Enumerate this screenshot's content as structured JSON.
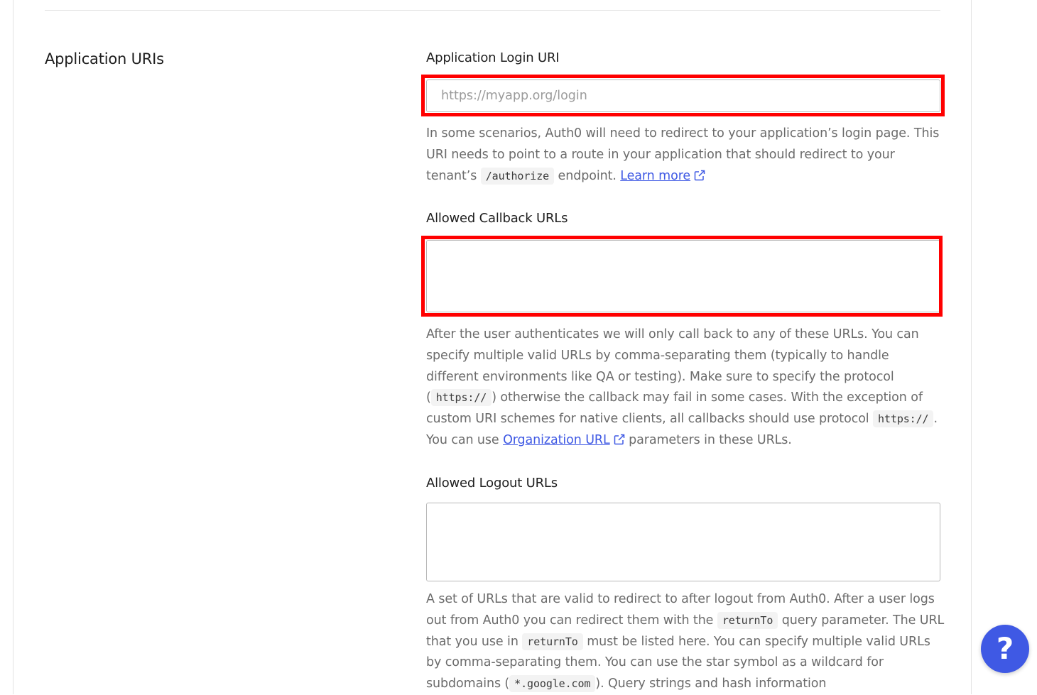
{
  "section": {
    "title": "Application URIs"
  },
  "login_uri": {
    "label": "Application Login URI",
    "placeholder": "https://myapp.org/login",
    "value": "",
    "help_1": "In some scenarios, Auth0 will need to redirect to your application’s login page. This URI needs to point to a route in your application that should redirect to your tenant’s",
    "help_code": "/authorize",
    "help_2": "endpoint.",
    "link": "Learn more"
  },
  "callback_urls": {
    "label": "Allowed Callback URLs",
    "value": "",
    "help_1": "After the user authenticates we will only call back to any of these URLs. You can specify multiple valid URLs by comma-separating them (typically to handle different environments like QA or testing). Make sure to specify the protocol (",
    "help_code_1": "https://",
    "help_2": ") otherwise the callback may fail in some cases. With the exception of custom URI schemes for native clients, all callbacks should use protocol",
    "help_code_2": "https://",
    "help_3": ". You can use",
    "link": "Organization URL",
    "help_4": "parameters in these URLs."
  },
  "logout_urls": {
    "label": "Allowed Logout URLs",
    "value": "",
    "help_1": "A set of URLs that are valid to redirect to after logout from Auth0. After a user logs out from Auth0 you can redirect them with the",
    "help_code_1": "returnTo",
    "help_2": "query parameter. The URL that you use in",
    "help_code_2": "returnTo",
    "help_3": "must be listed here. You can specify multiple valid URLs by comma-separating them. You can use the star symbol as a wildcard for subdomains (",
    "help_code_3": "*.google.com",
    "help_4": "). Query strings and hash information"
  },
  "help_button": {
    "label": "?"
  },
  "colors": {
    "accent": "#3f59e4",
    "highlight": "#ff0000",
    "text": "#1f1f1f",
    "muted": "#6b6b6b"
  }
}
